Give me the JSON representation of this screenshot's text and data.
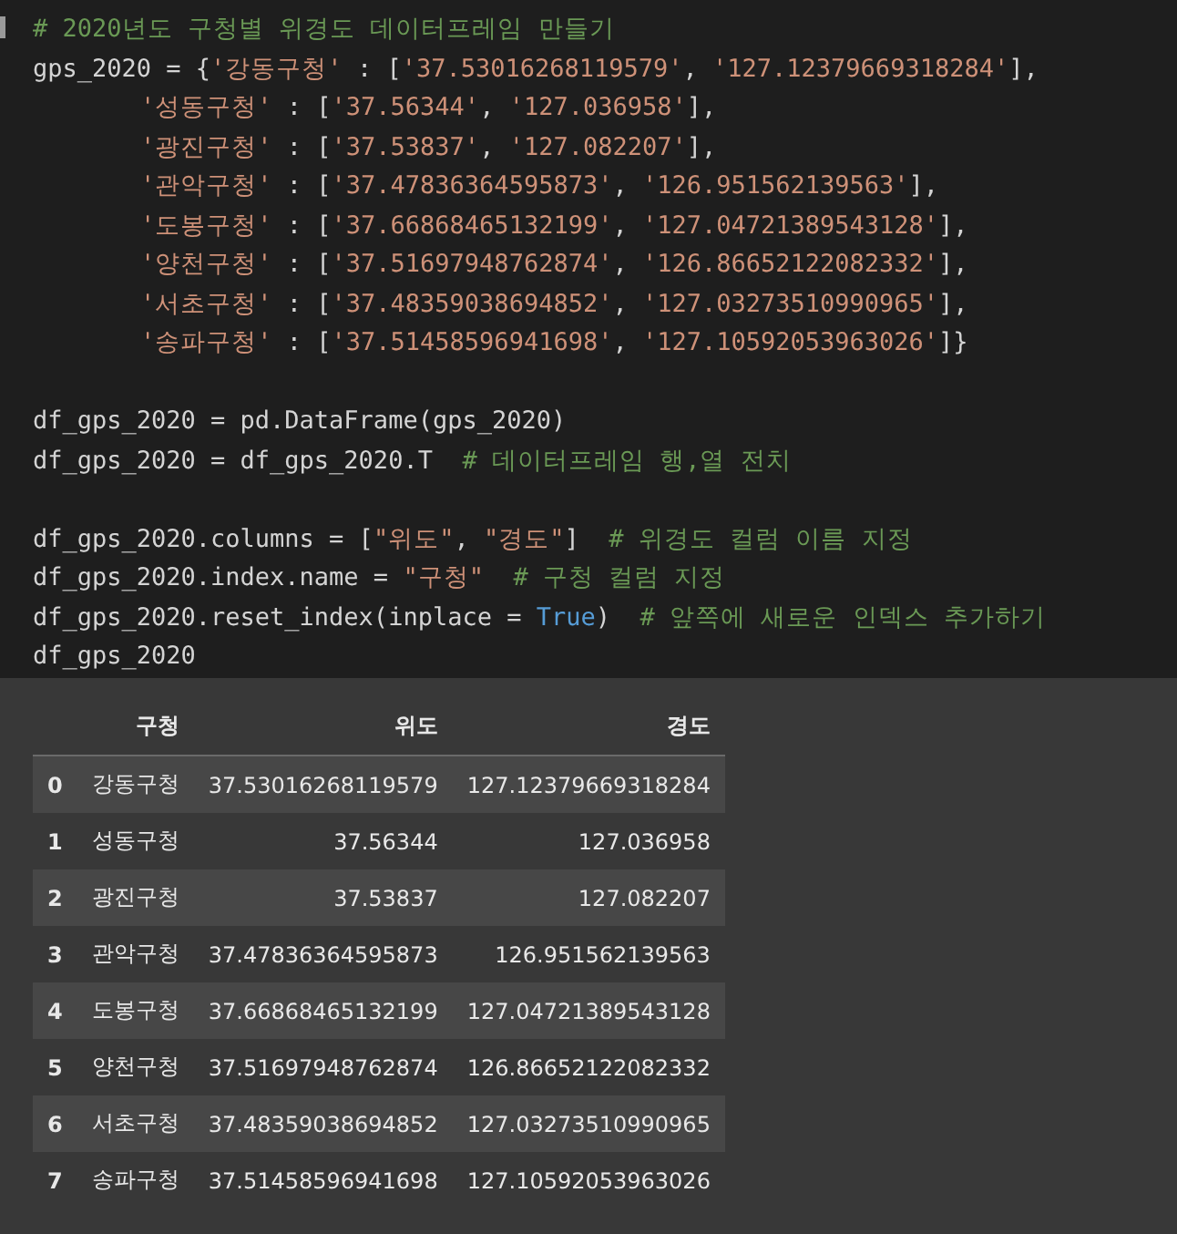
{
  "code_cell": {
    "blocks": [
      [
        {
          "indented": false,
          "tokens": [
            {
              "kind": "comment",
              "text": "# 2020년도 구청별 위경도 데이터프레임 만들기"
            }
          ]
        },
        {
          "indented": false,
          "tokens": [
            {
              "kind": "plain",
              "text": "gps_2020 = {"
            },
            {
              "kind": "string",
              "text": "'강동구청'"
            },
            {
              "kind": "plain",
              "text": " : ["
            },
            {
              "kind": "string",
              "text": "'37.53016268119579'"
            },
            {
              "kind": "plain",
              "text": ", "
            },
            {
              "kind": "string",
              "text": "'127.12379669318284'"
            },
            {
              "kind": "plain",
              "text": "],"
            }
          ]
        },
        {
          "indented": true,
          "tokens": [
            {
              "kind": "string",
              "text": "'성동구청'"
            },
            {
              "kind": "plain",
              "text": " : ["
            },
            {
              "kind": "string",
              "text": "'37.56344'"
            },
            {
              "kind": "plain",
              "text": ", "
            },
            {
              "kind": "string",
              "text": "'127.036958'"
            },
            {
              "kind": "plain",
              "text": "],"
            }
          ]
        },
        {
          "indented": true,
          "tokens": [
            {
              "kind": "string",
              "text": "'광진구청'"
            },
            {
              "kind": "plain",
              "text": " : ["
            },
            {
              "kind": "string",
              "text": "'37.53837'"
            },
            {
              "kind": "plain",
              "text": ", "
            },
            {
              "kind": "string",
              "text": "'127.082207'"
            },
            {
              "kind": "plain",
              "text": "],"
            }
          ]
        },
        {
          "indented": true,
          "tokens": [
            {
              "kind": "string",
              "text": "'관악구청'"
            },
            {
              "kind": "plain",
              "text": " : ["
            },
            {
              "kind": "string",
              "text": "'37.47836364595873'"
            },
            {
              "kind": "plain",
              "text": ", "
            },
            {
              "kind": "string",
              "text": "'126.951562139563'"
            },
            {
              "kind": "plain",
              "text": "],"
            }
          ]
        },
        {
          "indented": true,
          "tokens": [
            {
              "kind": "string",
              "text": "'도봉구청'"
            },
            {
              "kind": "plain",
              "text": " : ["
            },
            {
              "kind": "string",
              "text": "'37.66868465132199'"
            },
            {
              "kind": "plain",
              "text": ", "
            },
            {
              "kind": "string",
              "text": "'127.04721389543128'"
            },
            {
              "kind": "plain",
              "text": "],"
            }
          ]
        },
        {
          "indented": true,
          "tokens": [
            {
              "kind": "string",
              "text": "'양천구청'"
            },
            {
              "kind": "plain",
              "text": " : ["
            },
            {
              "kind": "string",
              "text": "'37.51697948762874'"
            },
            {
              "kind": "plain",
              "text": ", "
            },
            {
              "kind": "string",
              "text": "'126.86652122082332'"
            },
            {
              "kind": "plain",
              "text": "],"
            }
          ]
        },
        {
          "indented": true,
          "tokens": [
            {
              "kind": "string",
              "text": "'서초구청'"
            },
            {
              "kind": "plain",
              "text": " : ["
            },
            {
              "kind": "string",
              "text": "'37.48359038694852'"
            },
            {
              "kind": "plain",
              "text": ", "
            },
            {
              "kind": "string",
              "text": "'127.03273510990965'"
            },
            {
              "kind": "plain",
              "text": "],"
            }
          ]
        },
        {
          "indented": true,
          "tokens": [
            {
              "kind": "string",
              "text": "'송파구청'"
            },
            {
              "kind": "plain",
              "text": " : ["
            },
            {
              "kind": "string",
              "text": "'37.51458596941698'"
            },
            {
              "kind": "plain",
              "text": ", "
            },
            {
              "kind": "string",
              "text": "'127.10592053963026'"
            },
            {
              "kind": "plain",
              "text": "]}"
            }
          ]
        }
      ],
      [
        {
          "indented": false,
          "tokens": [
            {
              "kind": "plain",
              "text": "df_gps_2020 = pd.DataFrame(gps_2020)"
            }
          ]
        },
        {
          "indented": false,
          "tokens": [
            {
              "kind": "plain",
              "text": "df_gps_2020 = df_gps_2020.T"
            },
            {
              "kind": "comment",
              "text": "# 데이터프레임 행,열 전치"
            }
          ]
        }
      ],
      [
        {
          "indented": false,
          "tokens": [
            {
              "kind": "plain",
              "text": "df_gps_2020.columns = ["
            },
            {
              "kind": "string",
              "text": "\"위도\""
            },
            {
              "kind": "plain",
              "text": ", "
            },
            {
              "kind": "string",
              "text": "\"경도\""
            },
            {
              "kind": "plain",
              "text": "]"
            },
            {
              "kind": "comment",
              "text": "# 위경도 컬럼 이름 지정"
            }
          ]
        },
        {
          "indented": false,
          "tokens": [
            {
              "kind": "plain",
              "text": "df_gps_2020.index.name = "
            },
            {
              "kind": "string",
              "text": "\"구청\""
            },
            {
              "kind": "comment",
              "text": "# 구청 컬럼 지정"
            }
          ]
        },
        {
          "indented": false,
          "tokens": [
            {
              "kind": "plain",
              "text": "df_gps_2020.reset_index(inplace = "
            },
            {
              "kind": "keyword",
              "text": "True"
            },
            {
              "kind": "plain",
              "text": ")"
            },
            {
              "kind": "comment",
              "text": "# 앞쪽에 새로운 인덱스 추가하기"
            }
          ]
        },
        {
          "indented": false,
          "tokens": [
            {
              "kind": "plain",
              "text": "df_gps_2020"
            }
          ]
        }
      ]
    ]
  },
  "output_table": {
    "columns": [
      "구청",
      "위도",
      "경도"
    ],
    "rows": [
      {
        "index": "0",
        "cells": [
          "강동구청",
          "37.53016268119579",
          "127.12379669318284"
        ]
      },
      {
        "index": "1",
        "cells": [
          "성동구청",
          "37.56344",
          "127.036958"
        ]
      },
      {
        "index": "2",
        "cells": [
          "광진구청",
          "37.53837",
          "127.082207"
        ]
      },
      {
        "index": "3",
        "cells": [
          "관악구청",
          "37.47836364595873",
          "126.951562139563"
        ]
      },
      {
        "index": "4",
        "cells": [
          "도봉구청",
          "37.66868465132199",
          "127.04721389543128"
        ]
      },
      {
        "index": "5",
        "cells": [
          "양천구청",
          "37.51697948762874",
          "126.86652122082332"
        ]
      },
      {
        "index": "6",
        "cells": [
          "서초구청",
          "37.48359038694852",
          "127.03273510990965"
        ]
      },
      {
        "index": "7",
        "cells": [
          "송파구청",
          "37.51458596941698",
          "127.10592053963026"
        ]
      }
    ]
  }
}
